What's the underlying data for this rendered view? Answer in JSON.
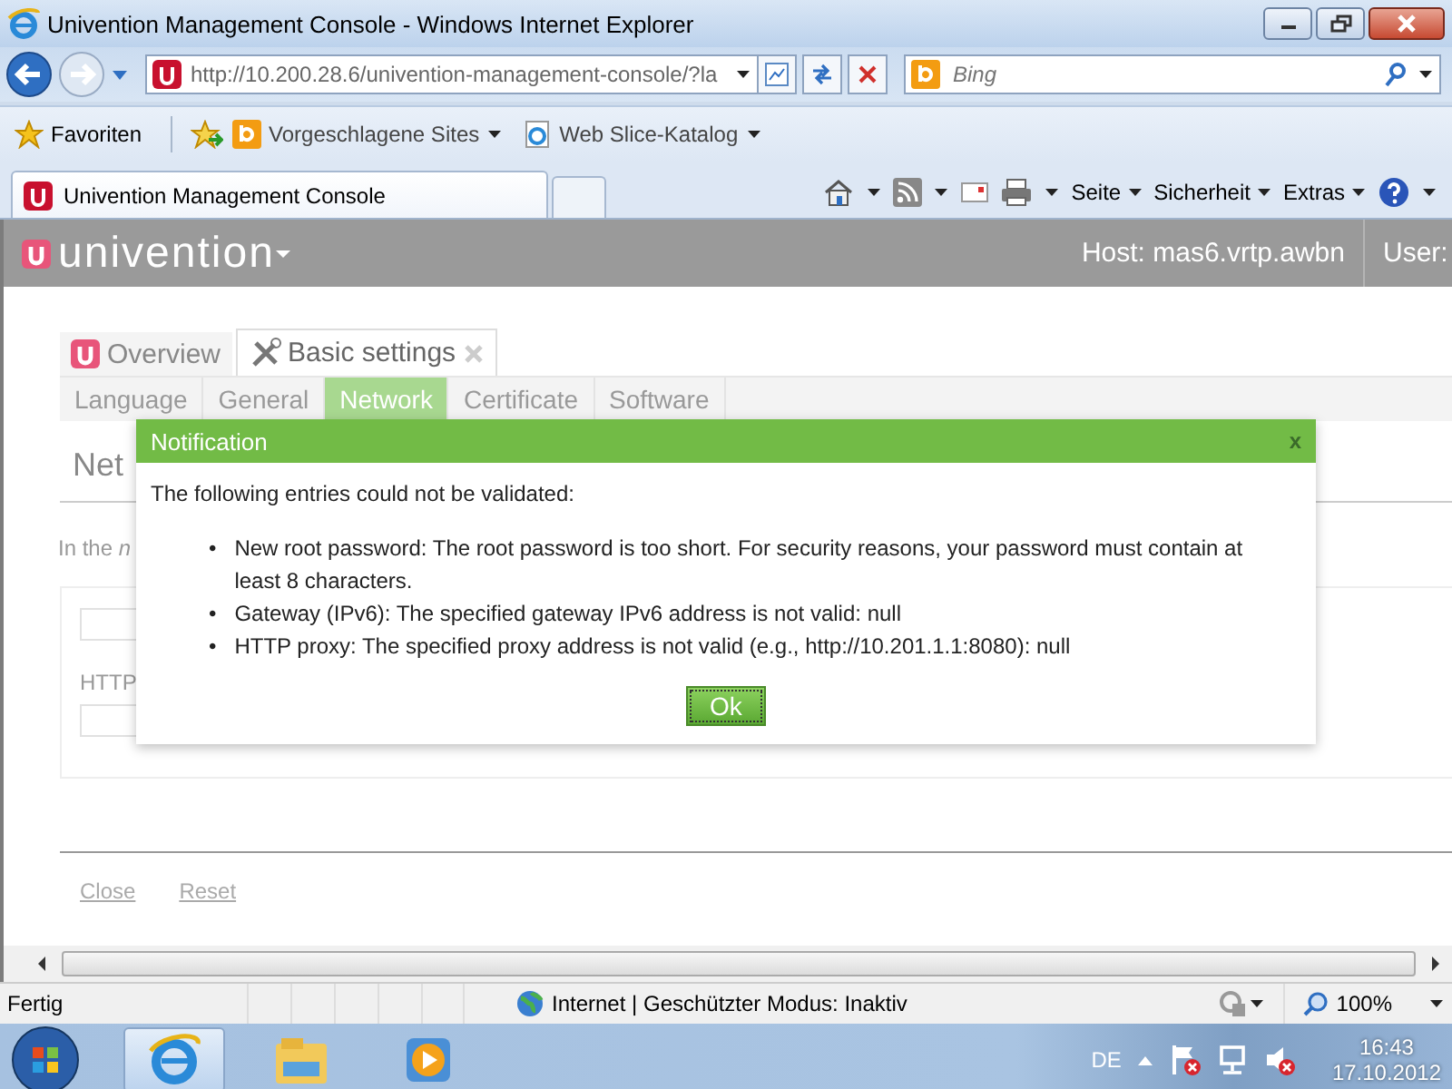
{
  "window": {
    "title": "Univention Management Console - Windows Internet Explorer"
  },
  "address_bar": {
    "url": "http://10.200.28.6/univention-management-console/?la"
  },
  "search": {
    "placeholder": "Bing"
  },
  "favorites_bar": {
    "favorites": "Favoriten",
    "items": [
      "Vorgeschlagene Sites",
      "Web Slice-Katalog"
    ]
  },
  "browser_tabs": [
    {
      "label": "Univention Management Console",
      "selected": true
    }
  ],
  "command_bar": [
    "Seite",
    "Sicherheit",
    "Extras"
  ],
  "app_header": {
    "logo": "univention",
    "host": "Host: mas6.vrtp.awbn",
    "user": "User:"
  },
  "module_tabs": [
    {
      "label": "Overview",
      "selected": false,
      "closable": false
    },
    {
      "label": "Basic settings",
      "selected": true,
      "closable": true
    }
  ],
  "sub_tabs": [
    {
      "label": "Language",
      "selected": false
    },
    {
      "label": "General",
      "selected": false
    },
    {
      "label": "Network",
      "selected": true
    },
    {
      "label": "Certificate",
      "selected": false
    },
    {
      "label": "Software",
      "selected": false
    }
  ],
  "page": {
    "heading": "Net",
    "intro": "In the *n*",
    "field_label": "HTTP"
  },
  "footer_links": [
    "Close",
    "Reset"
  ],
  "dialog": {
    "title": "Notification",
    "close": "x",
    "bullet": "•",
    "message": "The following entries could not be validated:",
    "items": [
      "New root password: The root password is too short. For security reasons, your password must contain at least 8 characters.",
      "Gateway (IPv6): The specified gateway IPv6 address is not valid: null",
      "HTTP proxy: The specified proxy address is not valid (e.g., http://10.201.1.1:8080): null"
    ],
    "ok": "Ok"
  },
  "status_bar": {
    "status": "Fertig",
    "zone": "Internet | Geschützter Modus: Inaktiv",
    "zoom": "100%"
  },
  "taskbar": {
    "language": "DE",
    "time": "16:43",
    "date": "17.10.2012"
  }
}
